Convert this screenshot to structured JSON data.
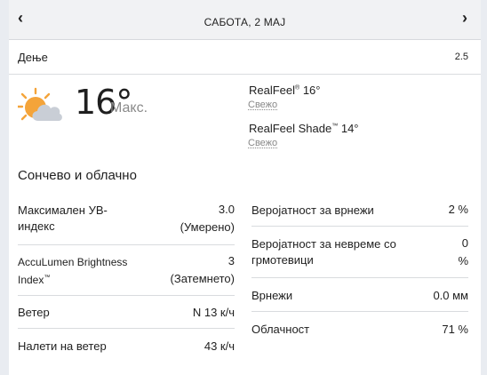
{
  "header": {
    "date": "САБОТА, 2 МАЈ",
    "prev": "‹",
    "next": "›"
  },
  "day": {
    "label": "Дење",
    "value": "2.5"
  },
  "current": {
    "icon": "partly-sunny-cloud-icon",
    "temp": "16°",
    "temp_label": "Макс.",
    "realfeel_label": "RealFeel",
    "realfeel_tm": "®",
    "realfeel_value": " 16°",
    "realfeel_desc": "Свежо",
    "shade_label": "RealFeel Shade",
    "shade_tm": "™",
    "shade_value": " 14°",
    "shade_desc": "Свежо"
  },
  "phrase": "Сончево и облачно",
  "details_left": [
    {
      "label": "Максимален УВ-индекс",
      "value_l1": "3.0",
      "value_l2": "(Умерено)"
    },
    {
      "label": "AccuLumen Brightness Index",
      "label_tm": "™",
      "value_l1": "3",
      "value_l2": "(Затемнето)"
    },
    {
      "label": "Ветер",
      "value_l1": "N 13 к/ч"
    },
    {
      "label": "Налети на ветер",
      "value_l1": "43 к/ч"
    }
  ],
  "details_right": [
    {
      "label": "Веројатност за врнежи",
      "value_l1": "2 %"
    },
    {
      "label": "Веројатност за невреме со грмотевици",
      "value_l1": "0",
      "value_l2": "%"
    },
    {
      "label": "Врнежи",
      "value_l1": "0.0 мм"
    },
    {
      "label": "Облачност",
      "value_l1": "71 %"
    }
  ],
  "colors": {
    "sun": "#f4a43a",
    "cloud": "#c9ced6",
    "divider": "#d9dbde"
  }
}
